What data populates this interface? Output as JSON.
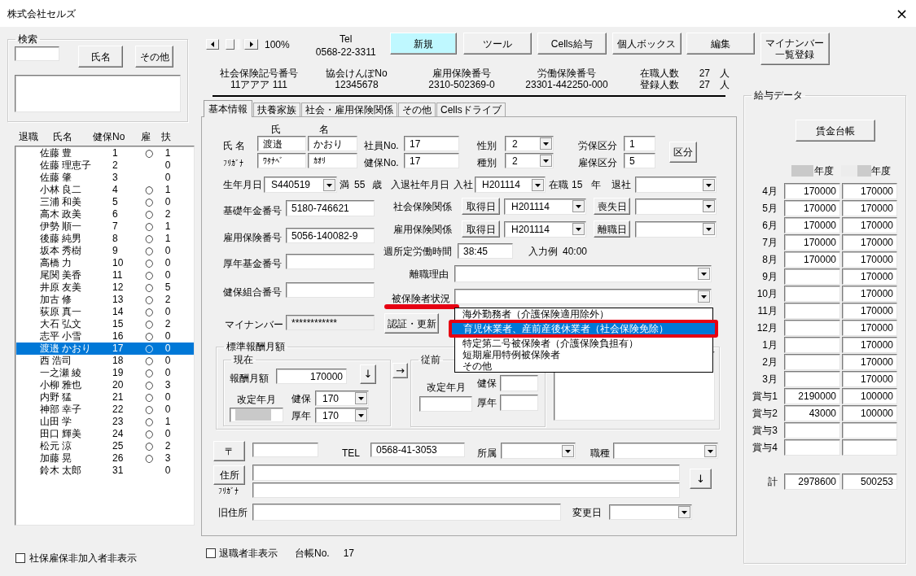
{
  "window": {
    "title": "株式会社セルズ",
    "close": "×"
  },
  "search": {
    "title": "検索",
    "buttons": [
      "氏名",
      "その他"
    ]
  },
  "employees": {
    "columns": [
      "退職",
      "氏名",
      "健保No",
      "雇",
      "扶"
    ],
    "rows": [
      {
        "name": "佐藤 豊",
        "health_no": "1",
        "employment": "○",
        "dependents": "1",
        "selected": false
      },
      {
        "name": "佐藤 理恵子",
        "health_no": "2",
        "dependents": "0",
        "selected": false
      },
      {
        "name": "佐藤 肇",
        "health_no": "3",
        "dependents": "0",
        "selected": false
      },
      {
        "name": "小林 良二",
        "health_no": "4",
        "employment": "○",
        "dependents": "1",
        "selected": false
      },
      {
        "name": "三浦 和美",
        "health_no": "5",
        "employment": "○",
        "dependents": "0",
        "selected": false
      },
      {
        "name": "高木 政美",
        "health_no": "6",
        "employment": "○",
        "dependents": "2",
        "selected": false
      },
      {
        "name": "伊勢 順一",
        "health_no": "7",
        "employment": "○",
        "dependents": "1",
        "selected": false
      },
      {
        "name": "後藤 純男",
        "health_no": "8",
        "employment": "○",
        "dependents": "1",
        "selected": false
      },
      {
        "name": "坂本 秀樹",
        "health_no": "9",
        "employment": "○",
        "dependents": "0",
        "selected": false
      },
      {
        "name": "高橋 力",
        "health_no": "10",
        "employment": "○",
        "dependents": "0",
        "selected": false
      },
      {
        "name": "尾関 美香",
        "health_no": "11",
        "employment": "○",
        "dependents": "0",
        "selected": false
      },
      {
        "name": "井原 友美",
        "health_no": "12",
        "employment": "○",
        "dependents": "5",
        "selected": false
      },
      {
        "name": "加古 修",
        "health_no": "13",
        "employment": "○",
        "dependents": "2",
        "selected": false
      },
      {
        "name": "荻原 真一",
        "health_no": "14",
        "employment": "○",
        "dependents": "0",
        "selected": false
      },
      {
        "name": "大石 弘文",
        "health_no": "15",
        "employment": "○",
        "dependents": "2",
        "selected": false
      },
      {
        "name": "志平 小雪",
        "health_no": "16",
        "employment": "○",
        "dependents": "0",
        "selected": false
      },
      {
        "name": "渡邉 かおり",
        "health_no": "17",
        "employment": "○",
        "dependents": "0",
        "selected": true
      },
      {
        "name": "西 浩司",
        "health_no": "18",
        "employment": "○",
        "dependents": "0",
        "selected": false
      },
      {
        "name": "一之瀬 綾",
        "health_no": "19",
        "employment": "○",
        "dependents": "0",
        "selected": false
      },
      {
        "name": "小柳 雅也",
        "health_no": "20",
        "employment": "○",
        "dependents": "3",
        "selected": false
      },
      {
        "name": "内野 猛",
        "health_no": "21",
        "employment": "○",
        "dependents": "0",
        "selected": false
      },
      {
        "name": "神部 幸子",
        "health_no": "22",
        "employment": "○",
        "dependents": "0",
        "selected": false
      },
      {
        "name": "山田 学",
        "health_no": "23",
        "employment": "○",
        "dependents": "1",
        "selected": false
      },
      {
        "name": "田口 輝美",
        "health_no": "24",
        "employment": "○",
        "dependents": "0",
        "selected": false
      },
      {
        "name": "松元 涼",
        "health_no": "25",
        "employment": "○",
        "dependents": "2",
        "selected": false
      },
      {
        "name": "加藤 晃",
        "health_no": "26",
        "employment": "○",
        "dependents": "3",
        "selected": false
      },
      {
        "name": "鈴木 太郎",
        "health_no": "31",
        "dependents": "0",
        "selected": false
      }
    ]
  },
  "hide_uninsured": {
    "label": "社保雇保非加入者非表示",
    "checked": false
  },
  "toolbar": {
    "zoom": "100%",
    "tel_label": "Tel",
    "tel": "0568-22-3311",
    "buttons": [
      {
        "label": "新規",
        "highlighted": true
      },
      {
        "label": "ツール",
        "highlighted": false
      },
      {
        "label": "Cells給与",
        "highlighted": false
      },
      {
        "label": "個人ボックス",
        "highlighted": false
      },
      {
        "label": "編集",
        "highlighted": false
      },
      {
        "label": "マイナンバー一覧登録",
        "highlighted": false
      }
    ]
  },
  "company_info": [
    {
      "label": "社会保険記号番号",
      "value": "11アアア 111"
    },
    {
      "label": "協会けんぽNo",
      "value": "12345678"
    },
    {
      "label": "雇用保険番号",
      "value": "2310-502369-0"
    },
    {
      "label": "労働保険番号",
      "value": "23301-442250-000"
    }
  ],
  "headcount": [
    {
      "label": "在職人数",
      "value": "27",
      "unit": "人"
    },
    {
      "label": "登録人数",
      "value": "27",
      "unit": "人"
    }
  ],
  "tabs": [
    {
      "label": "基本情報",
      "selected": true
    },
    {
      "label": "扶養家族",
      "selected": false
    },
    {
      "label": "社会・雇用保険関係",
      "selected": false
    },
    {
      "label": "その他",
      "selected": false
    },
    {
      "label": "Cellsドライブ",
      "selected": false
    }
  ],
  "basic_info": {
    "name_headers": [
      "氏",
      "名"
    ],
    "name": {
      "label": "氏 名",
      "values": [
        "渡邉",
        "かおり"
      ]
    },
    "furigana": {
      "label": "ﾌﾘｶﾞﾅ",
      "values": [
        "ﾜﾀﾅﾍﾞ",
        "ｶｵﾘ"
      ]
    },
    "employee_no": {
      "label": "社員No.",
      "value": "17"
    },
    "health_no": {
      "label": "健保No.",
      "value": "17"
    },
    "gender": {
      "label": "性別",
      "value": "2"
    },
    "category": {
      "label": "種別",
      "value": "2"
    },
    "labor_class": {
      "label": "労保区分",
      "value": "1"
    },
    "employment_class": {
      "label": "雇保区分",
      "value": "5"
    },
    "class_button": "区分",
    "birth": {
      "label": "生年月日",
      "value": "S440519",
      "age_prefix": "満",
      "age": "55",
      "age_unit": "歳"
    },
    "tenure": {
      "label": "入退社年月日",
      "join_label": "入社",
      "join": "H201114",
      "years_prefix": "在職",
      "years": "15",
      "years_unit": "年",
      "leave_label": "退社"
    },
    "left_fields": [
      {
        "label": "基礎年金番号",
        "value": "5180-746621",
        "disabled": false
      },
      {
        "label": "雇用保険番号",
        "value": "5056-140082-9",
        "disabled": false
      },
      {
        "label": "厚年基金番号",
        "disabled": false
      },
      {
        "label": "健保組合番号",
        "disabled": false
      },
      {
        "label": "マイナンバー",
        "value": "************",
        "disabled": true
      }
    ],
    "insurance": [
      {
        "label": "社会保険関係",
        "acquire_button": "取得日",
        "acquire": "H201114",
        "loss_button": "喪失日"
      },
      {
        "label": "雇用保険関係",
        "acquire_button": "取得日",
        "acquire": "H201114",
        "loss_button": "離職日"
      }
    ],
    "weekly_hours": {
      "label": "週所定労働時間",
      "value": "38:45",
      "example_label": "入力例",
      "example": "40:00"
    },
    "leave_reason": {
      "label": "離職理由"
    },
    "insured_status": {
      "label": "被保険者状況",
      "annotated": true,
      "expanded": true,
      "options": [
        {
          "label": "海外勤務者（介護保険適用除外）",
          "selected": false,
          "annotated": false
        },
        {
          "label": "育児休業者、産前産後休業者（社会保険免除）",
          "selected": true,
          "annotated": true
        },
        {
          "label": "特定第二号被保険者（介護保険負担有）",
          "selected": false,
          "annotated": false
        },
        {
          "label": "短期雇用特例被保険者",
          "selected": false,
          "annotated": false
        },
        {
          "label": "その他",
          "selected": false,
          "annotated": false
        }
      ]
    },
    "auth_button": "認証・更新",
    "standard_pay": {
      "title": "標準報酬月額",
      "current": {
        "title": "現在",
        "pay_label": "報酬月額",
        "pay": "170000",
        "copy_button": "↓",
        "revision_label": "改定年月",
        "health_label": "健保",
        "health": "170",
        "pension_label": "厚年",
        "pension": "170"
      },
      "transfer_button": "→",
      "previous": {
        "title": "従前",
        "revision_label": "改定年月",
        "health_label": "健保",
        "pension_label": "厚年"
      }
    },
    "contact": {
      "postal_button": "〒",
      "tel_label": "TEL",
      "tel": "0568-41-3053",
      "dept_label": "所属",
      "job_label": "職種",
      "address_button": "住所",
      "furigana_label": "ﾌﾘｶﾞﾅ",
      "copy_button": "↓",
      "old_address_label": "旧住所",
      "change_date_label": "変更日"
    }
  },
  "salary_data": {
    "title": "給与データ",
    "ledger_button": "賃金台帳",
    "year_headers": [
      "年度",
      "年度"
    ],
    "rows": [
      {
        "label": "4月",
        "year_1": "170000",
        "year_2": "170000"
      },
      {
        "label": "5月",
        "year_1": "170000",
        "year_2": "170000"
      },
      {
        "label": "6月",
        "year_1": "170000",
        "year_2": "170000"
      },
      {
        "label": "7月",
        "year_1": "170000",
        "year_2": "170000"
      },
      {
        "label": "8月",
        "year_1": "170000",
        "year_2": "170000"
      },
      {
        "label": "9月",
        "year_2": "170000"
      },
      {
        "label": "10月",
        "year_2": "170000"
      },
      {
        "label": "11月",
        "year_2": "170000"
      },
      {
        "label": "12月",
        "year_2": "170000"
      },
      {
        "label": "1月",
        "year_2": "170000"
      },
      {
        "label": "2月",
        "year_2": "170000"
      },
      {
        "label": "3月",
        "year_2": "170000"
      },
      {
        "label": "賞与1",
        "year_1": "2190000",
        "year_2": "100000"
      },
      {
        "label": "賞与2",
        "year_1": "43000",
        "year_2": "100000"
      },
      {
        "label": "賞与3"
      },
      {
        "label": "賞与4"
      }
    ],
    "total": {
      "label": "計",
      "year_1": "2978600",
      "year_2": "500253"
    }
  },
  "footer": {
    "hide_retired": {
      "label": "退職者非表示",
      "checked": false
    },
    "ledger_label": "台帳No.",
    "ledger_no": "17"
  }
}
